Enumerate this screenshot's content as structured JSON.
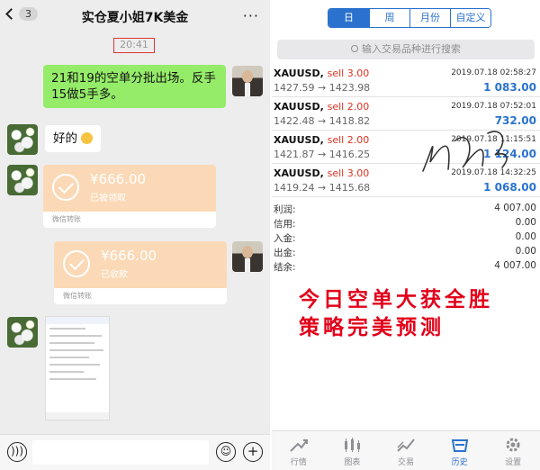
{
  "chat": {
    "badge": "3",
    "title": "实仓夏小姐7K美金",
    "more": "···",
    "timestamp": "20:41",
    "msg1": "21和19的空单分批出场。反手15做5手多。",
    "msg2": "好的",
    "transfer1": {
      "amount": "¥666.00",
      "status": "已被领取",
      "footer": "微信转账"
    },
    "transfer2": {
      "amount": "¥666.00",
      "status": "已收款",
      "footer": "微信转账"
    }
  },
  "mt": {
    "tabs": [
      {
        "label": "日",
        "active": true
      },
      {
        "label": "周",
        "active": false
      },
      {
        "label": "月份",
        "active": false
      },
      {
        "label": "自定义",
        "active": false
      }
    ],
    "search_placeholder": "输入交易品种进行搜索",
    "trades": [
      {
        "symbol": "XAUUSD,",
        "dir": "sell 3.00",
        "time": "2019.07.18 02:58:27",
        "prices": "1427.59 → 1423.98",
        "profit": "1 083.00"
      },
      {
        "symbol": "XAUUSD,",
        "dir": "sell 2.00",
        "time": "2019.07.18 07:52:01",
        "prices": "1422.48 → 1418.82",
        "profit": "732.00"
      },
      {
        "symbol": "XAUUSD,",
        "dir": "sell 2.00",
        "time": "2019.07.18 11:15:51",
        "prices": "1421.87 → 1416.25",
        "profit": "1 124.00"
      },
      {
        "symbol": "XAUUSD,",
        "dir": "sell 3.00",
        "time": "2019.07.18 14:32:25",
        "prices": "1419.24 → 1415.68",
        "profit": "1 068.00"
      }
    ],
    "summary": [
      {
        "label": "利润:",
        "value": "4 007.00"
      },
      {
        "label": "信用:",
        "value": "0.00"
      },
      {
        "label": "入金:",
        "value": "0.00"
      },
      {
        "label": "出金:",
        "value": "0.00"
      },
      {
        "label": "结余:",
        "value": "4 007.00"
      }
    ],
    "slogan_line1": "今日空单大获全胜",
    "slogan_line2": "策略完美预测",
    "nav": [
      {
        "label": "行情",
        "icon": "quotes-icon"
      },
      {
        "label": "图表",
        "icon": "chart-icon"
      },
      {
        "label": "交易",
        "icon": "trade-icon"
      },
      {
        "label": "历史",
        "icon": "history-icon",
        "active": true
      },
      {
        "label": "设置",
        "icon": "settings-icon"
      }
    ]
  },
  "colors": {
    "accent_blue": "#2b72ce",
    "sell_red": "#dd3322",
    "wechat_green": "#95ec69",
    "slogan_red": "#e2001a"
  }
}
